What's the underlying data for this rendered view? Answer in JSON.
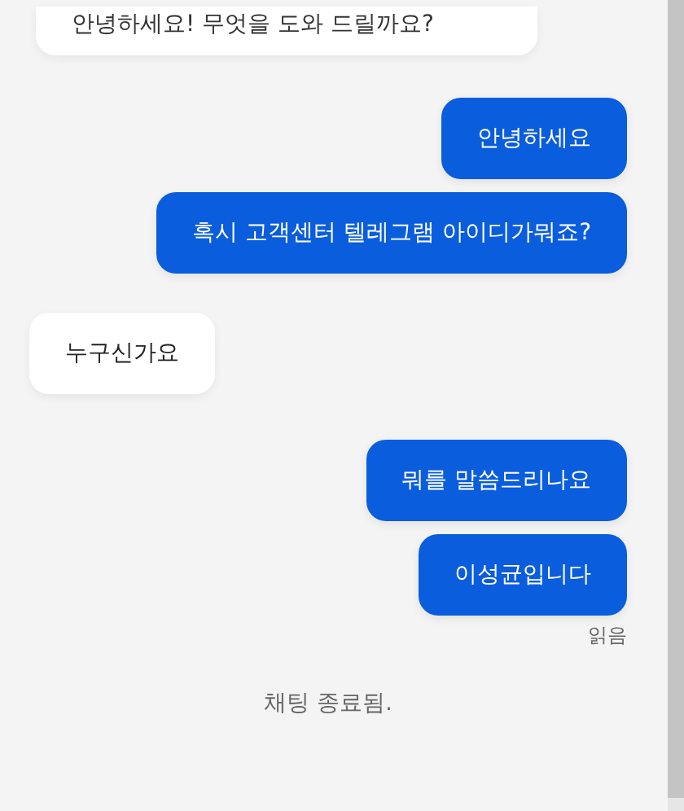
{
  "messages": [
    {
      "kind": "incoming",
      "text": "안녕하세요! 무엇을 도와 드릴까요?"
    },
    {
      "kind": "outgoing",
      "text": "안녕하세요"
    },
    {
      "kind": "outgoing",
      "text": "혹시 고객센터 텔레그램 아이디가뭐죠?"
    },
    {
      "kind": "incoming",
      "text": "누구신가요"
    },
    {
      "kind": "outgoing",
      "text": "뭐를 말씀드리나요"
    },
    {
      "kind": "outgoing",
      "text": "이성균입니다"
    }
  ],
  "read_receipt": "읽음",
  "status": "채팅 종료됨."
}
